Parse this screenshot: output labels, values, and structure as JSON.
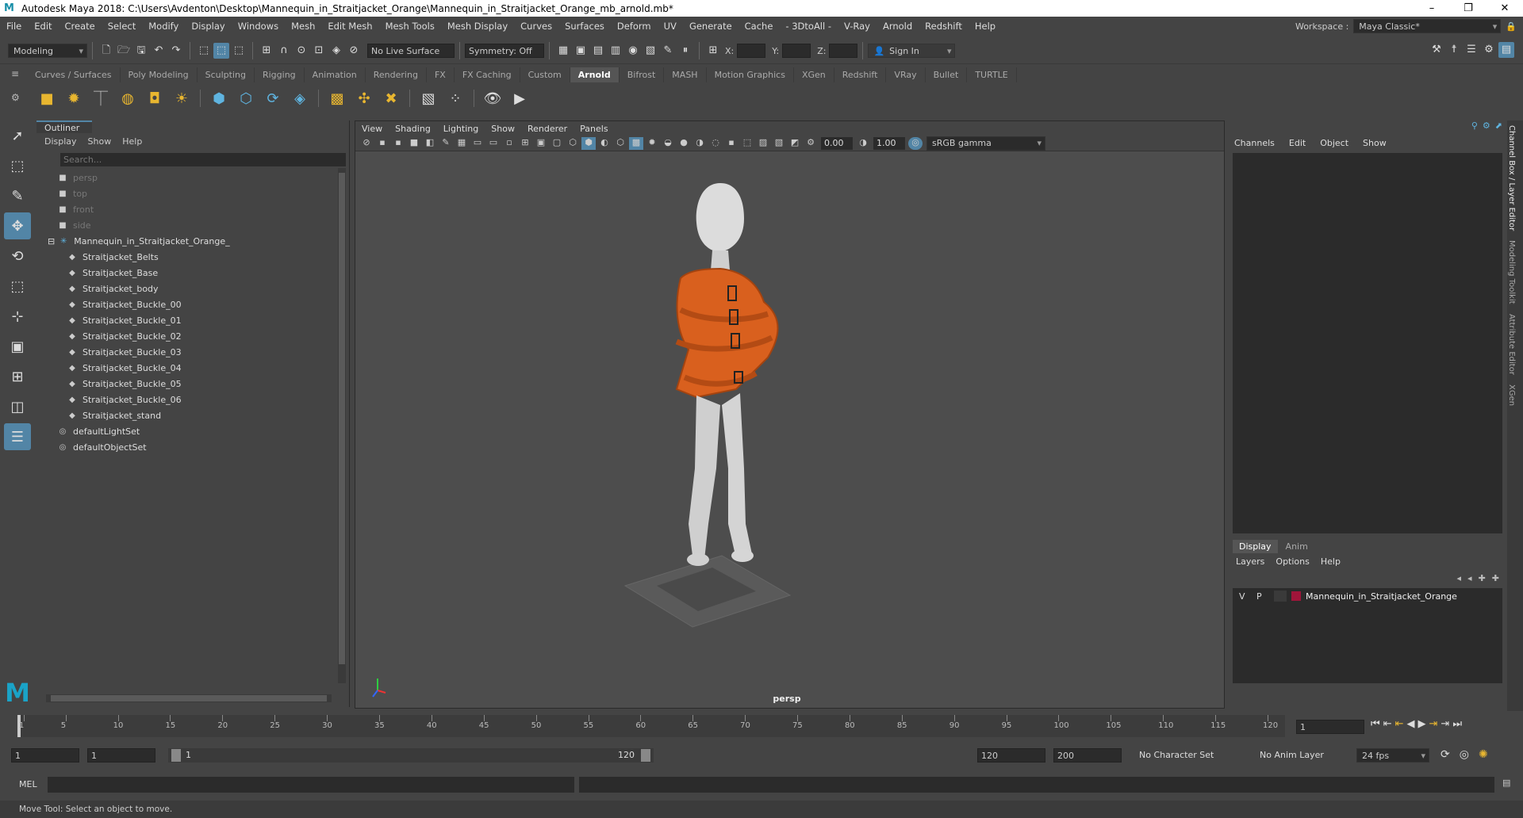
{
  "window": {
    "title": "Autodesk Maya 2018: C:\\Users\\Avdenton\\Desktop\\Mannequin_in_Straitjacket_Orange\\Mannequin_in_Straitjacket_Orange_mb_arnold.mb*",
    "logo": "M",
    "minimize": "–",
    "maximize": "❐",
    "close": "✕"
  },
  "menubar": {
    "items": [
      "File",
      "Edit",
      "Create",
      "Select",
      "Modify",
      "Display",
      "Windows",
      "Mesh",
      "Edit Mesh",
      "Mesh Tools",
      "Mesh Display",
      "Curves",
      "Surfaces",
      "Deform",
      "UV",
      "Generate",
      "Cache",
      "- 3DtoAll -",
      "V-Ray",
      "Arnold",
      "Redshift",
      "Help"
    ],
    "workspace_label": "Workspace :",
    "workspace_value": "Maya Classic*"
  },
  "statusline": {
    "mode": "Modeling",
    "live_surface": "No Live Surface",
    "symmetry": "Symmetry: Off",
    "x_label": "X:",
    "y_label": "Y:",
    "z_label": "Z:",
    "sign_in": "Sign In"
  },
  "shelf": {
    "tabs": [
      "Curves / Surfaces",
      "Poly Modeling",
      "Sculpting",
      "Rigging",
      "Animation",
      "Rendering",
      "FX",
      "FX Caching",
      "Custom",
      "Arnold",
      "Bifrost",
      "MASH",
      "Motion Graphics",
      "XGen",
      "Redshift",
      "VRay",
      "Bullet",
      "TURTLE"
    ],
    "active": "Arnold"
  },
  "outliner": {
    "title": "Outliner",
    "menu": [
      "Display",
      "Show",
      "Help"
    ],
    "search_placeholder": "Search...",
    "items": [
      {
        "label": "persp",
        "icon": "camera-icon",
        "dim": true,
        "indent": 1
      },
      {
        "label": "top",
        "icon": "camera-icon",
        "dim": true,
        "indent": 1
      },
      {
        "label": "front",
        "icon": "camera-icon",
        "dim": true,
        "indent": 1
      },
      {
        "label": "side",
        "icon": "camera-icon",
        "dim": true,
        "indent": 1
      },
      {
        "label": "Mannequin_in_Straitjacket_Orange_",
        "icon": "group-icon",
        "dim": false,
        "indent": 0
      },
      {
        "label": "Straitjacket_Belts",
        "icon": "mesh-icon",
        "dim": false,
        "indent": 2
      },
      {
        "label": "Straitjacket_Base",
        "icon": "mesh-icon",
        "dim": false,
        "indent": 2
      },
      {
        "label": "Straitjacket_body",
        "icon": "mesh-icon",
        "dim": false,
        "indent": 2
      },
      {
        "label": "Straitjacket_Buckle_00",
        "icon": "mesh-icon",
        "dim": false,
        "indent": 2
      },
      {
        "label": "Straitjacket_Buckle_01",
        "icon": "mesh-icon",
        "dim": false,
        "indent": 2
      },
      {
        "label": "Straitjacket_Buckle_02",
        "icon": "mesh-icon",
        "dim": false,
        "indent": 2
      },
      {
        "label": "Straitjacket_Buckle_03",
        "icon": "mesh-icon",
        "dim": false,
        "indent": 2
      },
      {
        "label": "Straitjacket_Buckle_04",
        "icon": "mesh-icon",
        "dim": false,
        "indent": 2
      },
      {
        "label": "Straitjacket_Buckle_05",
        "icon": "mesh-icon",
        "dim": false,
        "indent": 2
      },
      {
        "label": "Straitjacket_Buckle_06",
        "icon": "mesh-icon",
        "dim": false,
        "indent": 2
      },
      {
        "label": "Straitjacket_stand",
        "icon": "mesh-icon",
        "dim": false,
        "indent": 2
      },
      {
        "label": "defaultLightSet",
        "icon": "set-icon",
        "dim": false,
        "indent": 1
      },
      {
        "label": "defaultObjectSet",
        "icon": "set-icon",
        "dim": false,
        "indent": 1
      }
    ]
  },
  "viewport": {
    "menu": [
      "View",
      "Shading",
      "Lighting",
      "Show",
      "Renderer",
      "Panels"
    ],
    "near": "0.00",
    "far": "1.00",
    "colorspace": "sRGB gamma",
    "camera_label": "persp"
  },
  "channelbox": {
    "menu": [
      "Channels",
      "Edit",
      "Object",
      "Show"
    ]
  },
  "layereditor": {
    "tabs": [
      "Display",
      "Anim"
    ],
    "menu": [
      "Layers",
      "Options",
      "Help"
    ],
    "layer": {
      "v": "V",
      "p": "P",
      "name": "Mannequin_in_Straitjacket_Orange",
      "color": "#a0153a"
    }
  },
  "side_tabs": [
    "Channel Box / Layer Editor",
    "Modeling Toolkit",
    "Attribute Editor",
    "XGen"
  ],
  "timeline": {
    "ticks": [
      "1",
      "5",
      "10",
      "15",
      "20",
      "25",
      "30",
      "35",
      "40",
      "45",
      "50",
      "55",
      "60",
      "65",
      "70",
      "75",
      "80",
      "85",
      "90",
      "95",
      "100",
      "105",
      "110",
      "115",
      "120"
    ],
    "current_frame": "1"
  },
  "range": {
    "start": "1",
    "start2": "1",
    "slider_start": "1",
    "slider_end": "120",
    "end": "120",
    "end2": "200",
    "char_set": "No Character Set",
    "anim_layer": "No Anim Layer",
    "fps": "24 fps"
  },
  "cmdline": {
    "label": "MEL"
  },
  "helpline": {
    "text": "Move Tool: Select an object to move."
  }
}
